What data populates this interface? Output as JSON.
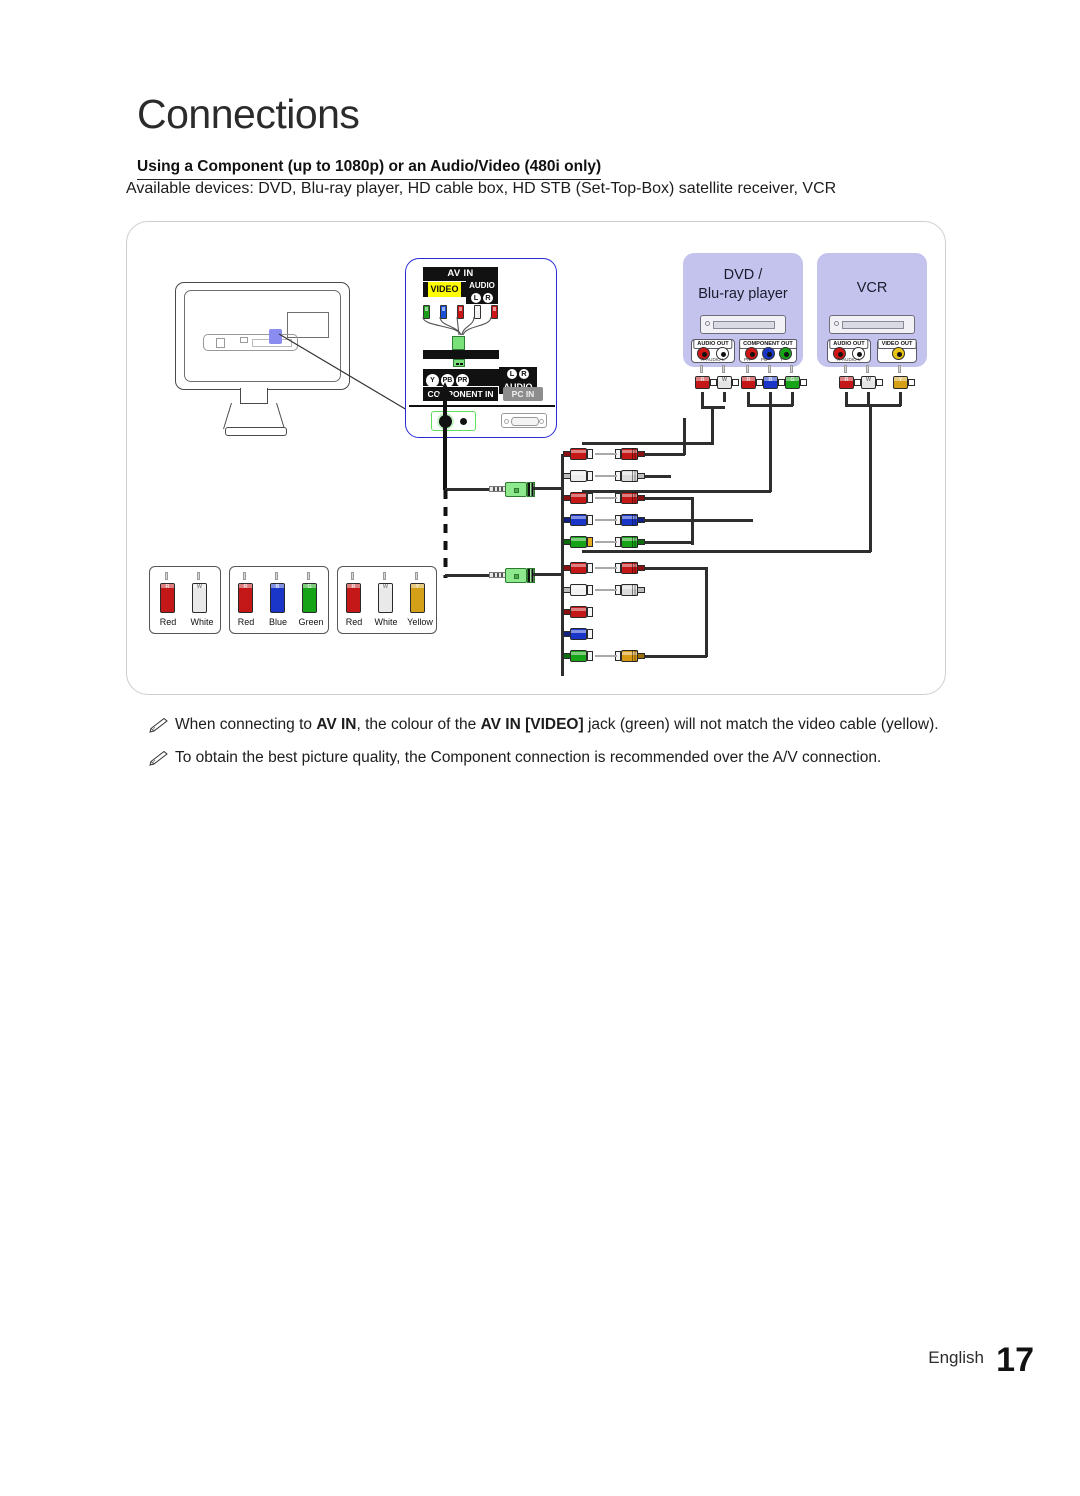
{
  "header": {
    "chapter_title": "Connections",
    "section_heading": "Using a Component (up to 1080p) or an Audio/Video (480i only)",
    "available_devices": "Available devices: DVD, Blu-ray player, HD cable box, HD STB (Set-Top-Box) satellite receiver, VCR"
  },
  "tv_panel": {
    "av_in": "AV IN",
    "video": "VIDEO",
    "audio_top": "AUDIO",
    "audio_left": "L",
    "audio_right": "R",
    "component_in": "COMPONENT IN",
    "pc_in": "PC IN",
    "audio_bottom": "AUDIO",
    "component_y": "Y",
    "component_pb": "PB",
    "component_pr": "PR",
    "minijack_colors": [
      "#1a9e1a",
      "#1a4fd6",
      "#cc1414",
      "#f2f2f2",
      "#cc1414"
    ]
  },
  "devices": [
    {
      "name": "dvd-blu-ray-player",
      "title_line1": "DVD /",
      "title_line2": "Blu-ray player",
      "port_groups": [
        {
          "label": "AUDIO OUT",
          "sub": "R-AUDIO-L",
          "jacks": [
            {
              "color": "#d01717",
              "name": "audio-right"
            },
            {
              "color": "#ffffff",
              "name": "audio-left"
            }
          ]
        },
        {
          "label": "COMPONENT OUT",
          "sub": "",
          "jacks": [
            {
              "color": "#d01717",
              "name": "pr",
              "label": "PR"
            },
            {
              "color": "#1a36c8",
              "name": "pb",
              "label": "PB"
            },
            {
              "color": "#17a317",
              "name": "y",
              "label": "Y"
            }
          ]
        }
      ]
    },
    {
      "name": "vcr",
      "title_line1": "VCR",
      "title_line2": "",
      "port_groups": [
        {
          "label": "AUDIO OUT",
          "sub": "R-AUDIO-L",
          "jacks": [
            {
              "color": "#d01717",
              "name": "audio-right"
            },
            {
              "color": "#ffffff",
              "name": "audio-left"
            }
          ]
        },
        {
          "label": "VIDEO OUT",
          "sub": "",
          "jacks": [
            {
              "color": "#e8c412",
              "name": "video"
            }
          ]
        }
      ]
    }
  ],
  "legend": {
    "groups": [
      {
        "name": "audio-cable-legend",
        "plugs": [
          {
            "label": "Red",
            "color": "#c41717",
            "letter": "R"
          },
          {
            "label": "White",
            "color": "#e9e9e9",
            "letter": "W"
          }
        ]
      },
      {
        "name": "component-cable-legend",
        "plugs": [
          {
            "label": "Red",
            "color": "#c41717",
            "letter": "R"
          },
          {
            "label": "Blue",
            "color": "#1a36c8",
            "letter": "B"
          },
          {
            "label": "Green",
            "color": "#17a317",
            "letter": "G"
          }
        ]
      },
      {
        "name": "av-cable-legend",
        "plugs": [
          {
            "label": "Red",
            "color": "#c41717",
            "letter": "R"
          },
          {
            "label": "White",
            "color": "#e9e9e9",
            "letter": "W"
          },
          {
            "label": "Yellow",
            "color": "#d4a017",
            "letter": "Y"
          }
        ]
      }
    ]
  },
  "notes": [
    {
      "icon": "note-pencil-icon",
      "parts": [
        {
          "t": "When connecting to ",
          "b": false
        },
        {
          "t": "AV IN",
          "b": true
        },
        {
          "t": ", the colour of the ",
          "b": false
        },
        {
          "t": "AV IN [VIDEO]",
          "b": true
        },
        {
          "t": " jack (green) will not match the video cable (yellow).",
          "b": false
        }
      ]
    },
    {
      "icon": "note-pencil-icon",
      "parts": [
        {
          "t": "To obtain the best picture quality, the Component connection is recommended over the A/V connection.",
          "b": false
        }
      ]
    }
  ],
  "footer": {
    "language": "English",
    "page_number": "17"
  },
  "colors": {
    "device_box": "#c3c3ee",
    "highlight_blue": "#8a8cf0",
    "panel_outline": "#2b2bd6",
    "jack_green": "#5ce05c",
    "video_yellow": "#ffff00"
  }
}
